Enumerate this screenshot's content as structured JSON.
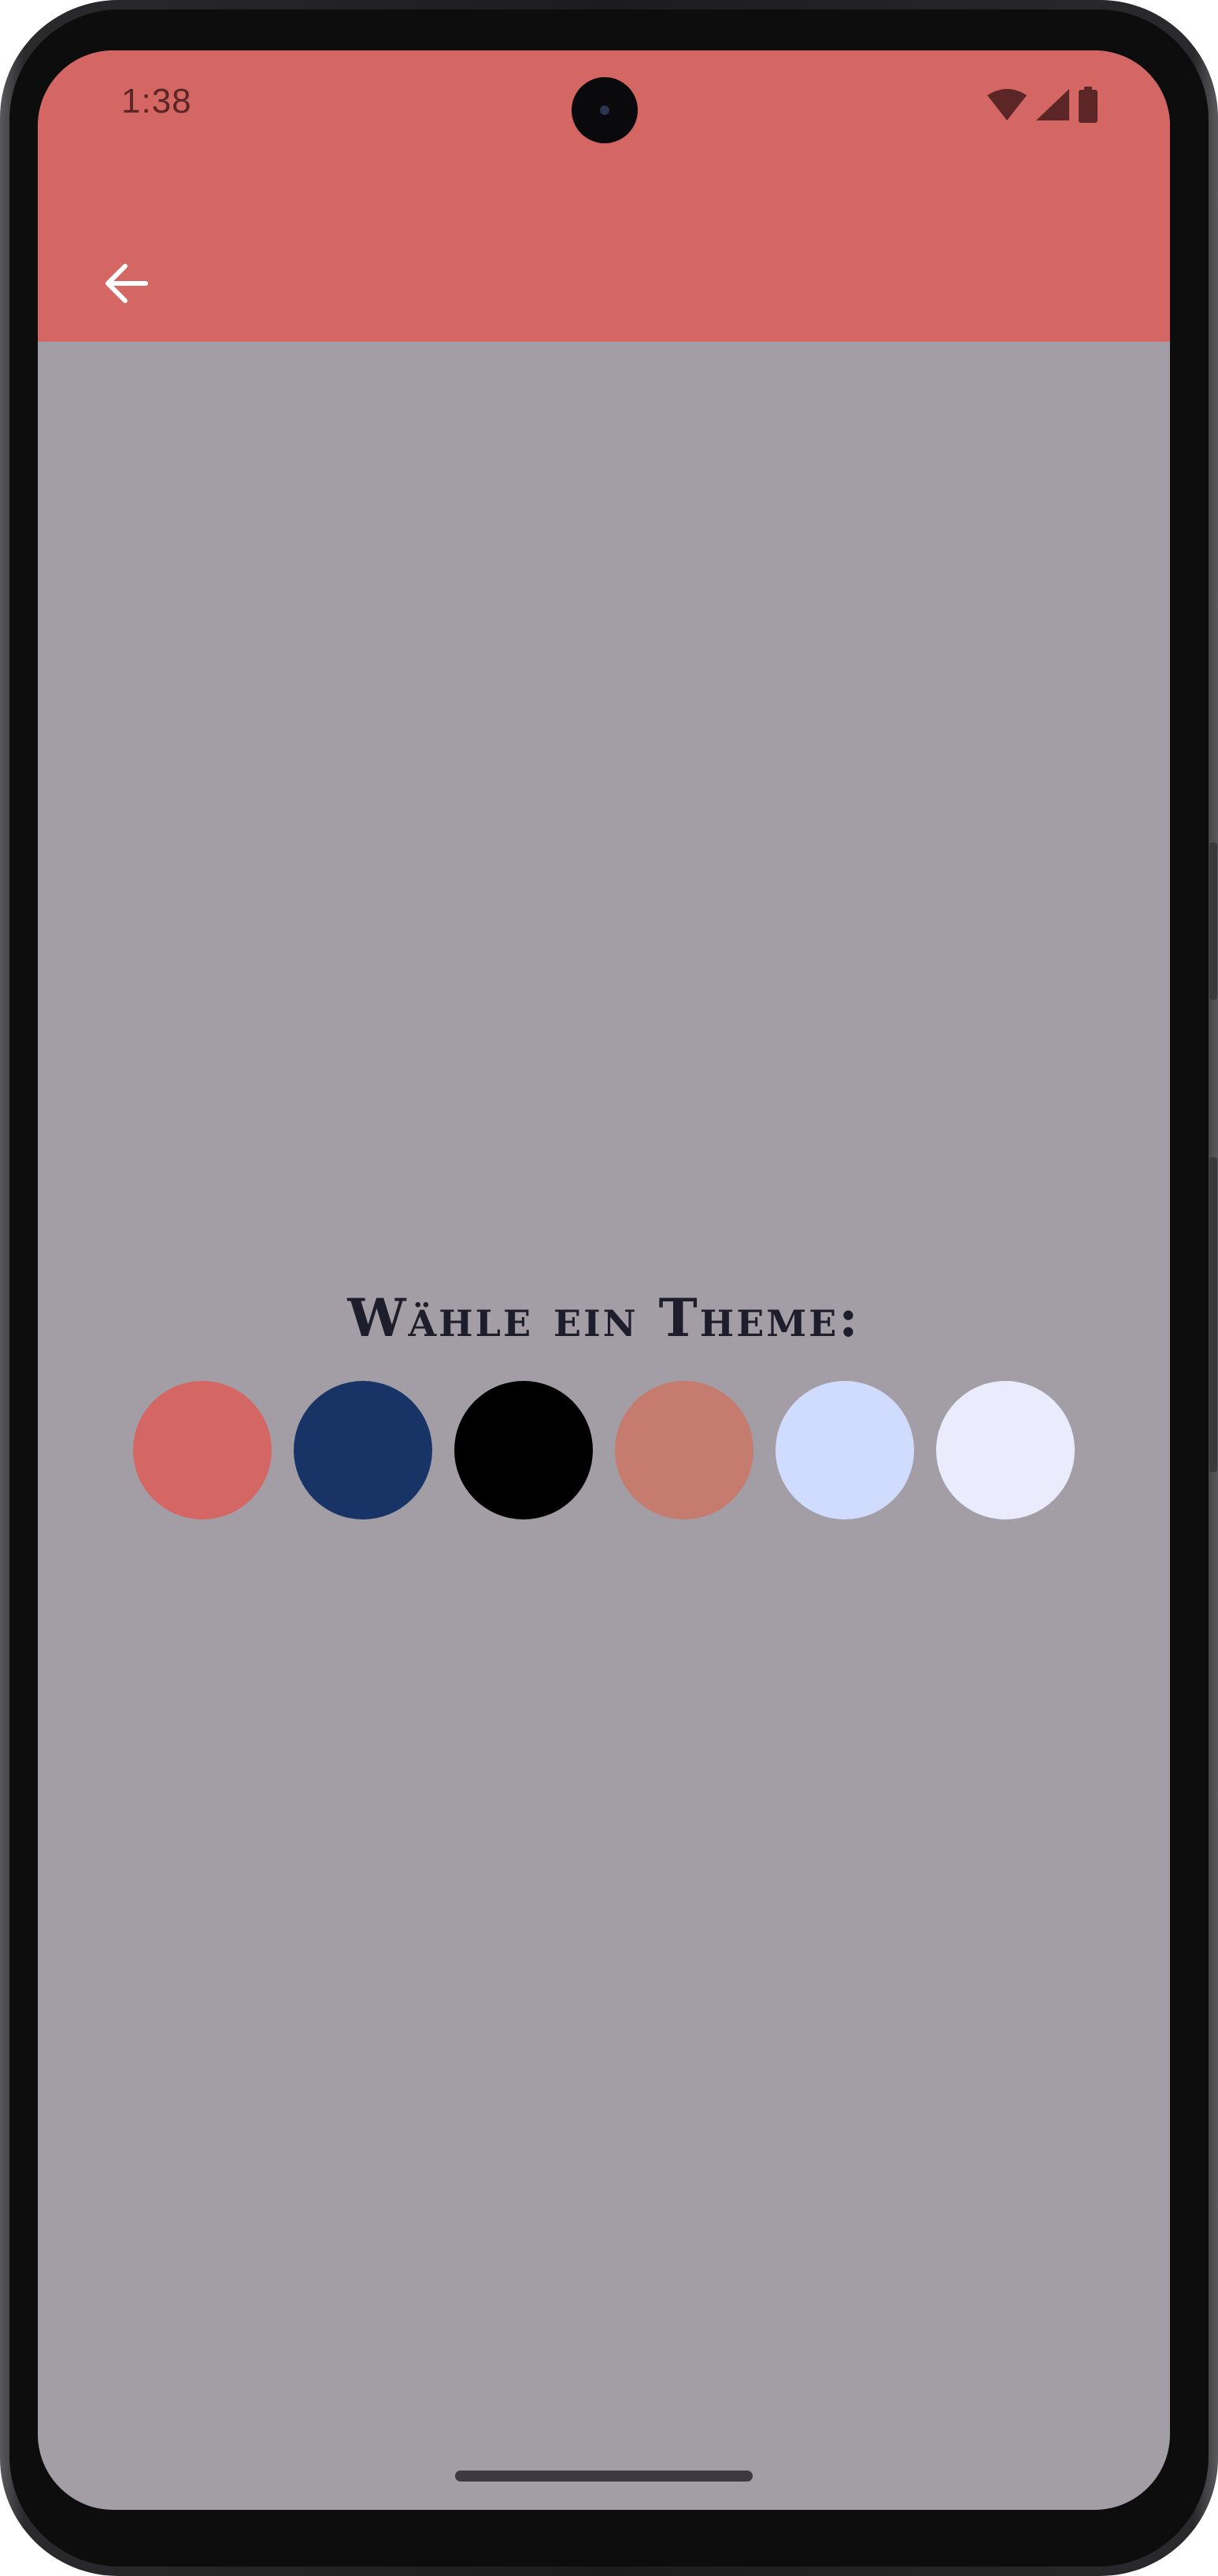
{
  "status_bar": {
    "time": "1:38",
    "icons": [
      "wifi-icon",
      "cellular-signal-icon",
      "battery-icon"
    ],
    "icon_color": "#5c2626"
  },
  "app_bar": {
    "background_color": "#d46664",
    "back_icon": "arrow-back-icon"
  },
  "screen": {
    "background_color": "#a39ea6"
  },
  "theme_picker": {
    "title": "Wähle ein Theme:",
    "swatches": [
      {
        "name": "red",
        "color": "#d46664"
      },
      {
        "name": "navy",
        "color": "#183466"
      },
      {
        "name": "black",
        "color": "#000000"
      },
      {
        "name": "terracotta",
        "color": "#c57b6d"
      },
      {
        "name": "light-blue",
        "color": "#d0dcfe"
      },
      {
        "name": "lavender-white",
        "color": "#eaecfe"
      }
    ]
  }
}
